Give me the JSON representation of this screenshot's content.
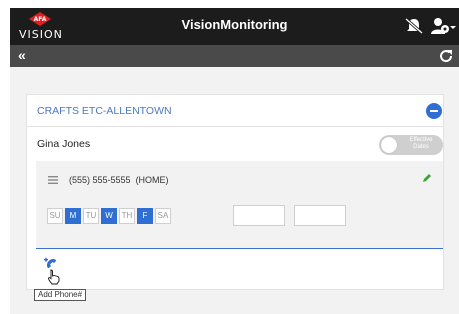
{
  "header": {
    "logo_text": "VISION",
    "logo_badge_text": "AFA",
    "app_title": "VisionMonitoring",
    "icons": [
      "notifications-off-icon",
      "user-menu-icon"
    ]
  },
  "subbar": {
    "collapse_label": "«",
    "icons": [
      "refresh-icon"
    ]
  },
  "card": {
    "store_name": "CRAFTS ETC-ALLENTOWN",
    "person_name": "Gina Jones",
    "toggle_label": "Effective Dates",
    "phone": {
      "number": "(555) 555-5555",
      "type": "(HOME)",
      "days": [
        {
          "label": "SU",
          "on": false
        },
        {
          "label": "M",
          "on": true
        },
        {
          "label": "TU",
          "on": false
        },
        {
          "label": "W",
          "on": true
        },
        {
          "label": "TH",
          "on": false
        },
        {
          "label": "F",
          "on": true
        },
        {
          "label": "SA",
          "on": false
        }
      ],
      "time_from": "",
      "time_to": ""
    },
    "add_phone_tooltip": "Add Phone#"
  },
  "colors": {
    "accent": "#2f6fd4",
    "header_bg": "#1c1c1c",
    "subbar_bg": "#4a4a4a",
    "store_name": "#4a78c2",
    "edit_green": "#3aa335"
  }
}
